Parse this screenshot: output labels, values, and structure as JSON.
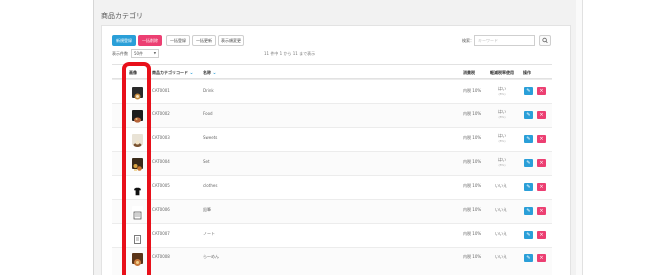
{
  "page_title": "商品カテゴリ",
  "toolbar": {
    "new_label": "新規登録",
    "bulk_delete_label": "一括削除",
    "bulk_add_label": "一括登録",
    "bulk_update_label": "一括更新",
    "display_order_label": "表示順変更"
  },
  "search": {
    "label": "検索：",
    "placeholder": "キーワード"
  },
  "pagination": {
    "per_page_label": "表示件数",
    "per_page_value": "50件",
    "count_text": "11 件中 1 から 11 まで表示"
  },
  "table": {
    "headers": {
      "image": "画像",
      "code": "商品カテゴリコード",
      "name": "名称",
      "tax": "消費税",
      "reduced": "軽減税率使用",
      "actions": "操作"
    },
    "rows": [
      {
        "code": "CAT0001",
        "name": "Drink",
        "tax": "内税 10%",
        "reduced": "はい",
        "reduced_sub": "(8%)"
      },
      {
        "code": "CAT0002",
        "name": "Food",
        "tax": "内税 10%",
        "reduced": "はい",
        "reduced_sub": "(8%)"
      },
      {
        "code": "CAT0003",
        "name": "Sweets",
        "tax": "内税 10%",
        "reduced": "はい",
        "reduced_sub": "(8%)"
      },
      {
        "code": "CAT0004",
        "name": "Set",
        "tax": "内税 10%",
        "reduced": "はい",
        "reduced_sub": "(8%)"
      },
      {
        "code": "CAT0005",
        "name": "clothes",
        "tax": "内税 10%",
        "reduced": "いいえ",
        "reduced_sub": ""
      },
      {
        "code": "CAT0006",
        "name": "鉛筆",
        "tax": "内税 10%",
        "reduced": "いいえ",
        "reduced_sub": ""
      },
      {
        "code": "CAT0007",
        "name": "ノート",
        "tax": "内税 10%",
        "reduced": "いいえ",
        "reduced_sub": ""
      },
      {
        "code": "CAT0008",
        "name": "ら～めん",
        "tax": "内税 10%",
        "reduced": "いいえ",
        "reduced_sub": ""
      }
    ]
  },
  "colors": {
    "accent_blue": "#2a9fd8",
    "accent_pink": "#ec3f72",
    "highlight_red": "#e8101a"
  }
}
